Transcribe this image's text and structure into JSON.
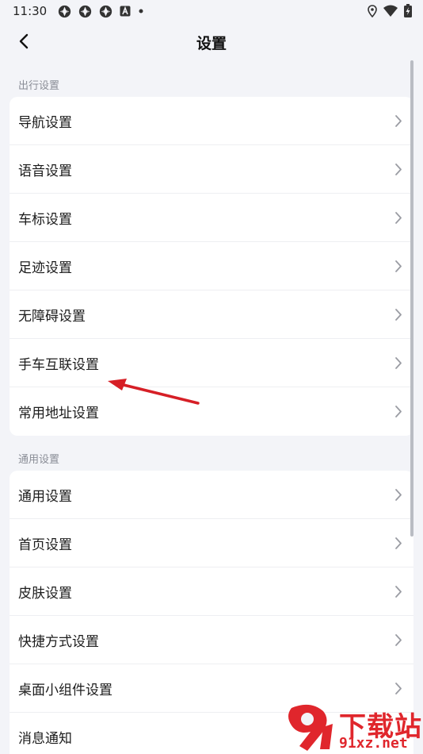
{
  "status_bar": {
    "time": "11:30",
    "left_icons": [
      "aperture-icon",
      "aperture-icon",
      "aperture-icon",
      "a-square-icon",
      "dot-icon"
    ],
    "right_icons": [
      "location-icon",
      "wifi-icon",
      "battery-charging-icon"
    ]
  },
  "header": {
    "title": "设置",
    "back_icon": "chevron-left-icon"
  },
  "sections": [
    {
      "title": "出行设置",
      "items": [
        {
          "label": "导航设置"
        },
        {
          "label": "语音设置"
        },
        {
          "label": "车标设置"
        },
        {
          "label": "足迹设置"
        },
        {
          "label": "无障碍设置"
        },
        {
          "label": "手车互联设置"
        },
        {
          "label": "常用地址设置"
        }
      ]
    },
    {
      "title": "通用设置",
      "items": [
        {
          "label": "通用设置"
        },
        {
          "label": "首页设置"
        },
        {
          "label": "皮肤设置"
        },
        {
          "label": "快捷方式设置"
        },
        {
          "label": "桌面小组件设置"
        },
        {
          "label": "消息通知"
        }
      ]
    }
  ],
  "annotation": {
    "type": "arrow",
    "color": "#d61f26",
    "target": "手车互联设置"
  },
  "watermark": {
    "top": "下载站",
    "bottom": "91xz.net",
    "color": "#e0262c"
  },
  "colors": {
    "background": "#f3f4f8",
    "card": "#ffffff",
    "section_title": "#8a8d96",
    "chevron": "#9a9ca3"
  }
}
